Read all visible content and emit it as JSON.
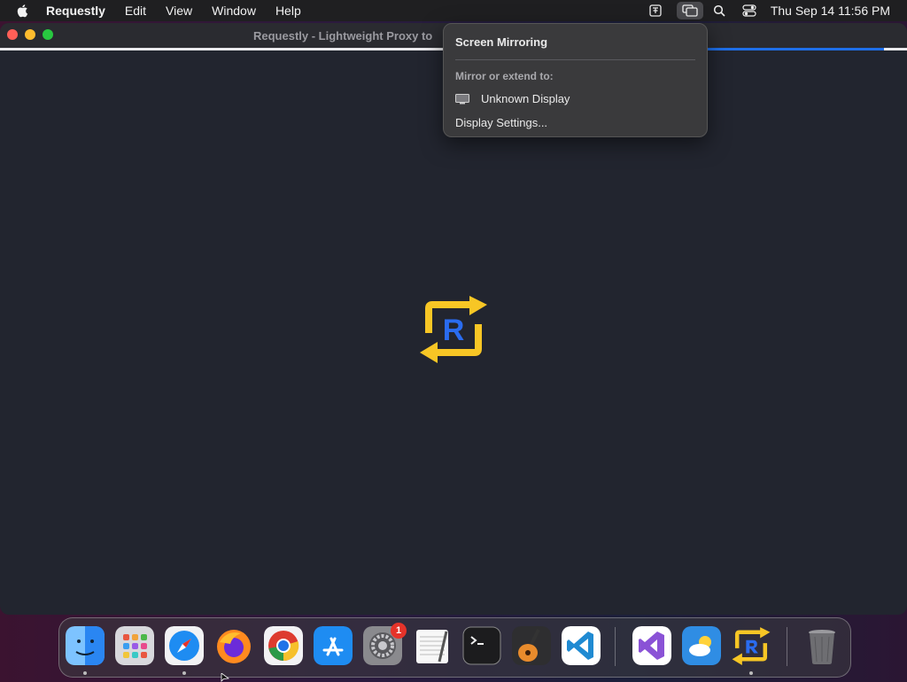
{
  "menubar": {
    "app_name": "Requestly",
    "menus": [
      "Edit",
      "View",
      "Window",
      "Help"
    ],
    "status_icons": [
      "display-icon",
      "screen-mirroring-icon",
      "search-icon",
      "control-center-icon"
    ],
    "clock": "Thu Sep 14  11:56 PM"
  },
  "window": {
    "title": "Requestly - Lightweight Proxy to",
    "loading_progress": 0.2,
    "accent_color": "#1f6fe8",
    "logo_letter": "R"
  },
  "popover": {
    "title": "Screen Mirroring",
    "section_label": "Mirror or extend to:",
    "device_label": "Unknown Display",
    "settings_label": "Display Settings..."
  },
  "dock": {
    "apps": [
      {
        "name": "Finder",
        "icon": "finder-icon"
      },
      {
        "name": "Launchpad",
        "icon": "launchpad-icon"
      },
      {
        "name": "Safari",
        "icon": "safari-icon"
      },
      {
        "name": "Firefox",
        "icon": "firefox-icon"
      },
      {
        "name": "Chrome",
        "icon": "chrome-icon"
      },
      {
        "name": "App Store",
        "icon": "app-store-icon"
      },
      {
        "name": "System Settings",
        "icon": "settings-icon",
        "badge": "1"
      },
      {
        "name": "TextEdit",
        "icon": "textedit-icon"
      },
      {
        "name": "Terminal",
        "icon": "terminal-icon"
      },
      {
        "name": "GarageBand",
        "icon": "garageband-icon"
      },
      {
        "name": "VS Code",
        "icon": "vscode-icon"
      },
      {
        "name": "Visual Studio",
        "icon": "visual-studio-icon"
      },
      {
        "name": "Weather",
        "icon": "weather-icon"
      },
      {
        "name": "Requestly",
        "icon": "requestly-icon"
      },
      {
        "name": "Trash",
        "icon": "trash-icon"
      }
    ],
    "settings_badge": "1"
  }
}
